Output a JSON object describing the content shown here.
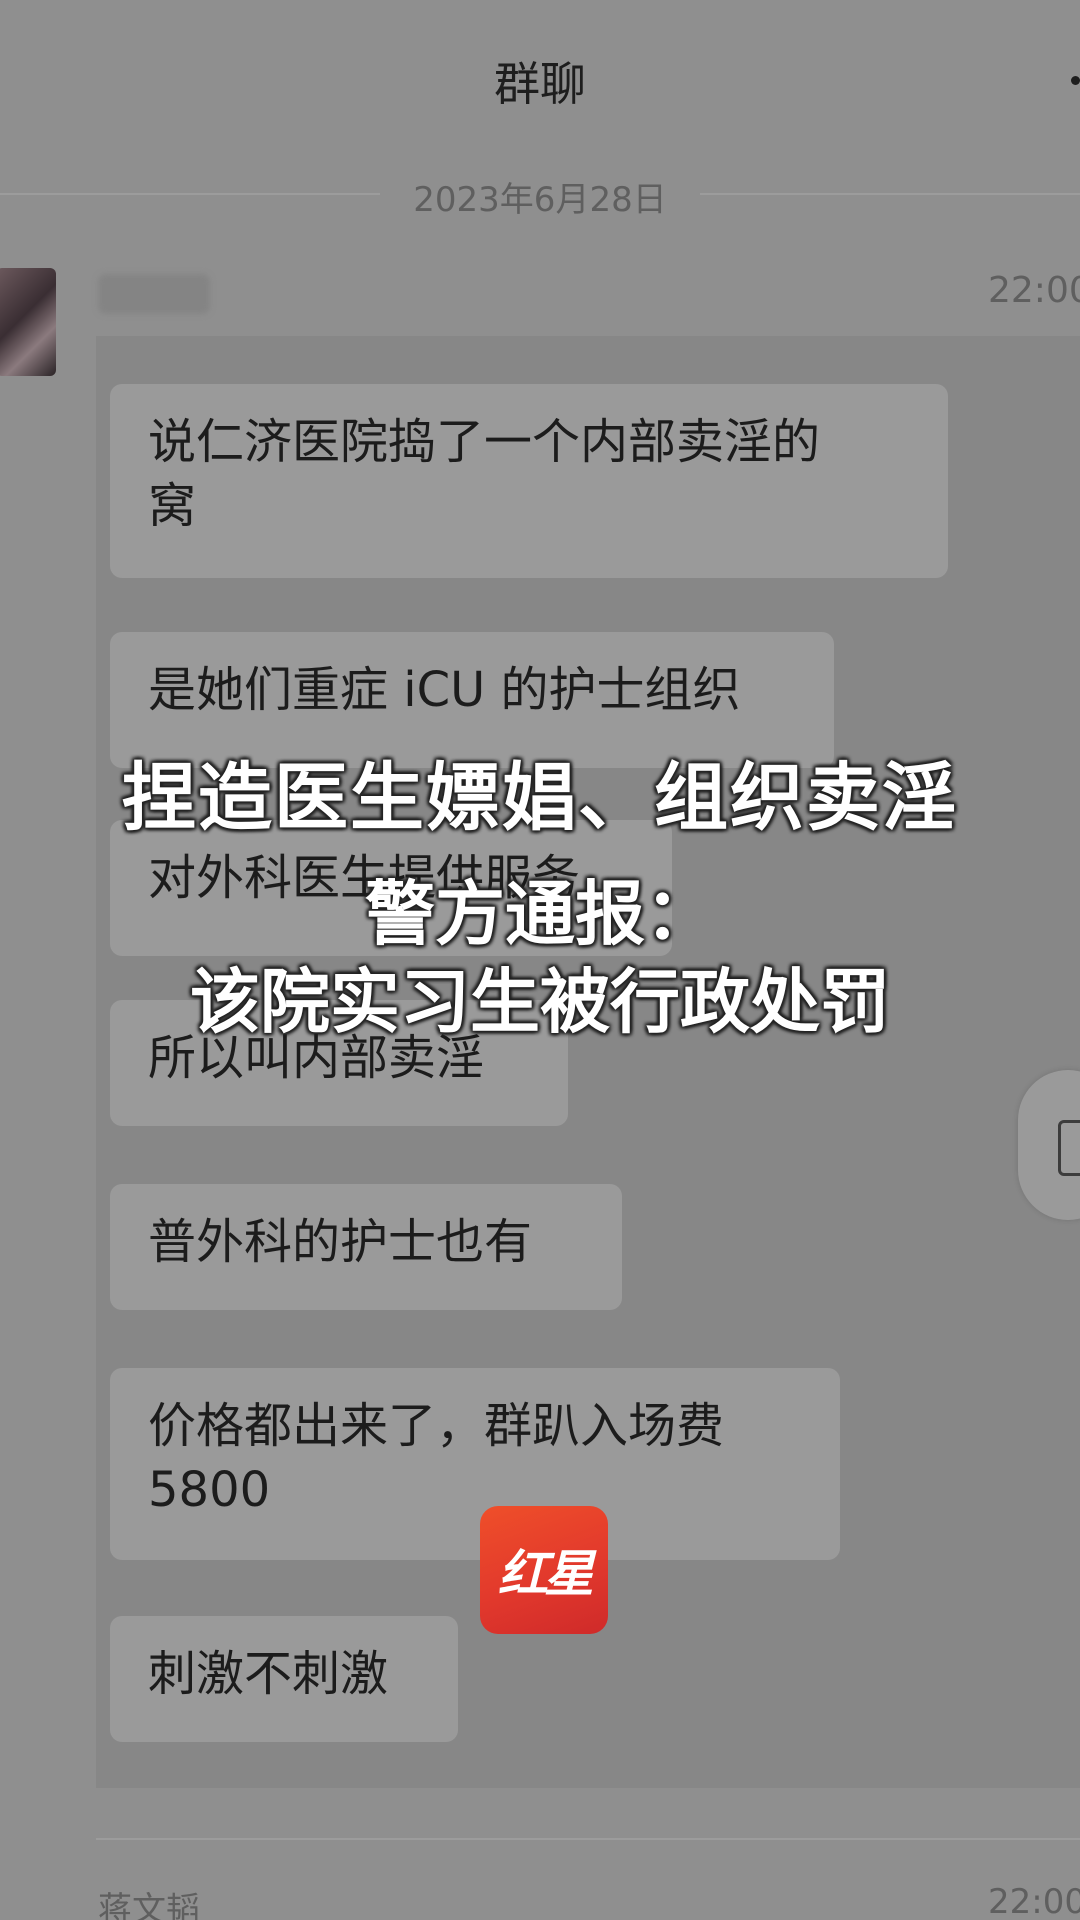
{
  "header": {
    "title": "群聊"
  },
  "chat": {
    "date": "2023年6月28日",
    "message_time": "22:00",
    "messages": [
      "说仁济医院捣了一个内部卖淫的\n窝",
      "是她们重症 iCU 的护士组织",
      "对外科医生提供服务",
      "所以叫内部卖淫",
      "普外科的护士也有",
      "价格都出来了，群趴入场费\n5800",
      "刺激不刺激"
    ],
    "next_sender": "蒋文韬",
    "next_time": "22:00"
  },
  "overlay": {
    "headline_line1": "捏造医生嫖娼、组织卖淫",
    "headline_line2": "警方通报：",
    "headline_line3": "该院实习生被行政处罚"
  },
  "watermark": {
    "logo_text": "红星",
    "logo_color": "#e2392c"
  }
}
